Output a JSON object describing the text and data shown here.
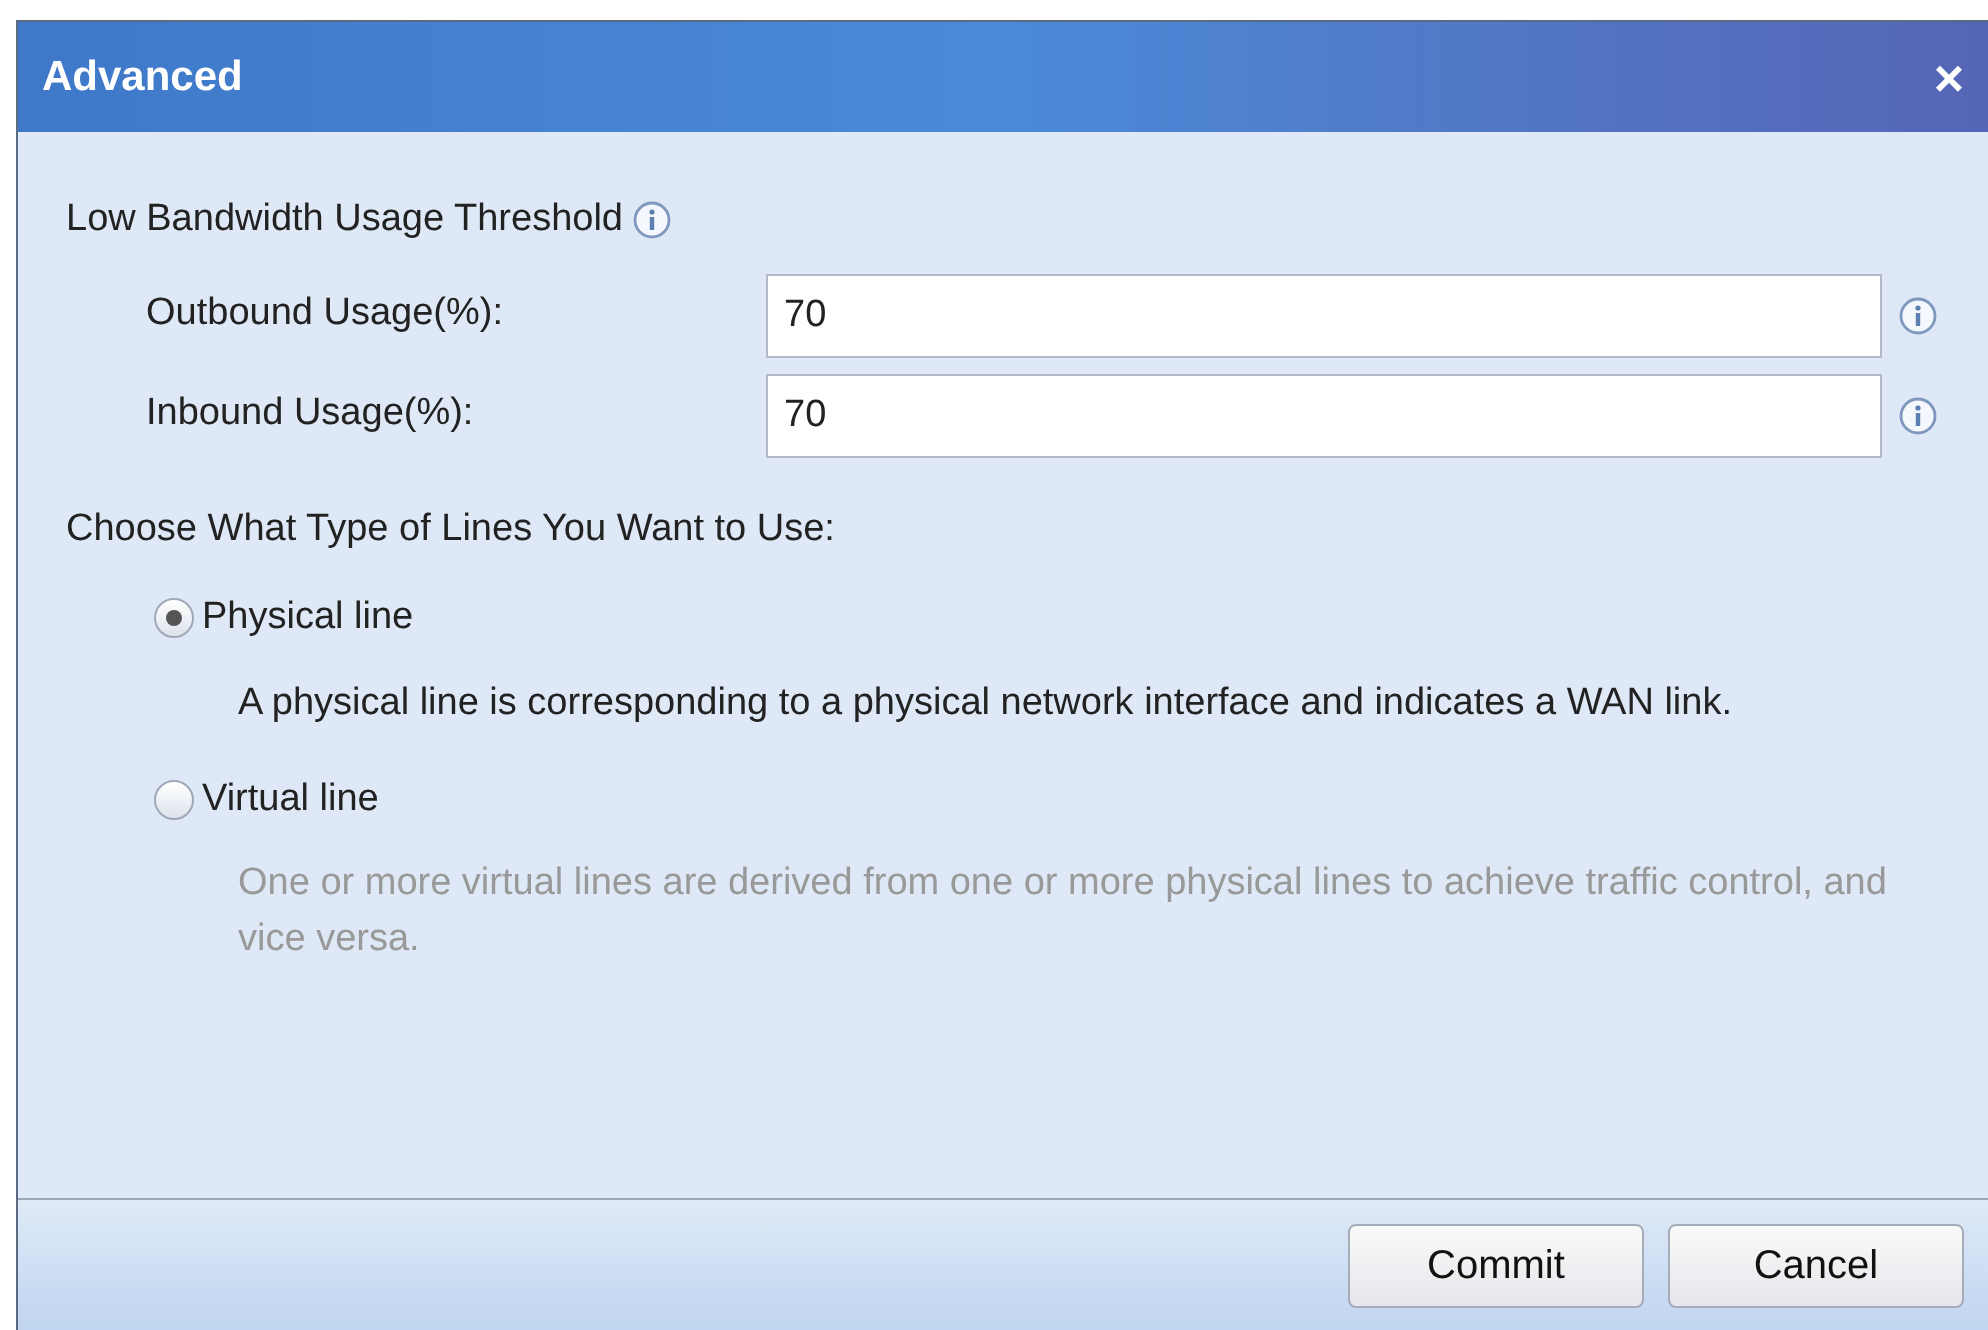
{
  "window": {
    "title": "Advanced",
    "close": "×"
  },
  "threshold": {
    "heading": "Low Bandwidth Usage Threshold",
    "fields": [
      {
        "label": "Outbound Usage(%):",
        "value": "70"
      },
      {
        "label": "Inbound Usage(%):",
        "value": "70"
      }
    ]
  },
  "line_type": {
    "heading": "Choose What Type of Lines You Want to Use:",
    "options": [
      {
        "label": "Physical line",
        "selected": true,
        "description": "A physical line is corresponding to a physical network interface and indicates a WAN link."
      },
      {
        "label": "Virtual line",
        "selected": false,
        "description": "One or more virtual lines are derived from one or more physical lines to achieve traffic control, and vice versa."
      }
    ]
  },
  "buttons": [
    "Commit",
    "Cancel"
  ]
}
